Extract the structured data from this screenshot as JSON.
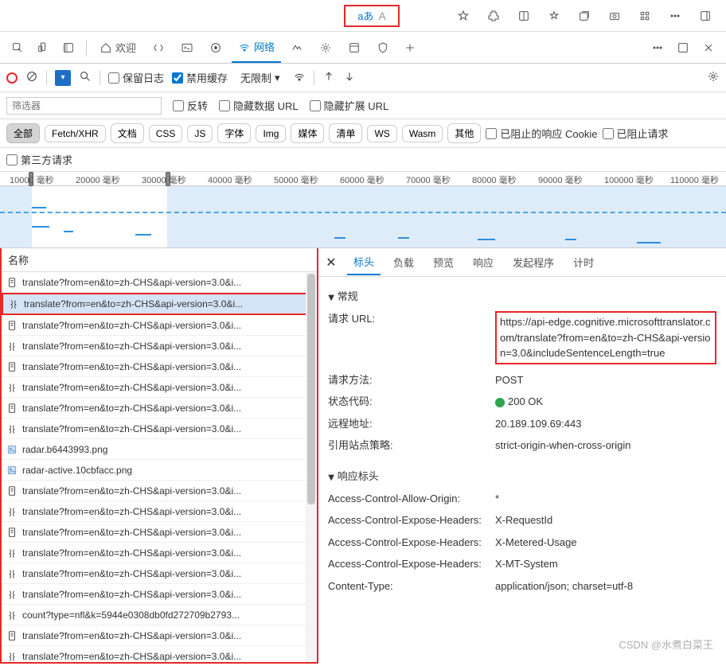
{
  "browserBar": {
    "translateBtn": {
      "label1": "aあ",
      "label2": "A"
    }
  },
  "tabs": {
    "welcome": "欢迎",
    "network": "网络"
  },
  "controls": {
    "preserveLog": "保留日志",
    "disableCache": "禁用缓存",
    "throttle": "无限制"
  },
  "filterRow": {
    "placeholder": "筛选器",
    "invert": "反转",
    "hideDataUrl": "隐藏数据 URL",
    "hideExtUrl": "隐藏扩展 URL"
  },
  "typeRow": {
    "all": "全部",
    "fetch": "Fetch/XHR",
    "doc": "文档",
    "css": "CSS",
    "js": "JS",
    "font": "字体",
    "img": "Img",
    "media": "媒体",
    "manifest": "清单",
    "ws": "WS",
    "wasm": "Wasm",
    "other": "其他",
    "blockedCookie": "已阻止的响应 Cookie",
    "blockedReq": "已阻止请求"
  },
  "thirdParty": "第三方请求",
  "timeline": {
    "ticks": [
      "10000 毫秒",
      "20000 毫秒",
      "30000 毫秒",
      "40000 毫秒",
      "50000 毫秒",
      "60000 毫秒",
      "70000 毫秒",
      "80000 毫秒",
      "90000 毫秒",
      "100000 毫秒",
      "110000 毫秒"
    ]
  },
  "listHeader": "名称",
  "requests": [
    {
      "name": "translate?from=en&to=zh-CHS&api-version=3.0&i...",
      "type": "doc",
      "selected": false
    },
    {
      "name": "translate?from=en&to=zh-CHS&api-version=3.0&i...",
      "type": "js",
      "selected": true
    },
    {
      "name": "translate?from=en&to=zh-CHS&api-version=3.0&i...",
      "type": "doc",
      "selected": false
    },
    {
      "name": "translate?from=en&to=zh-CHS&api-version=3.0&i...",
      "type": "js",
      "selected": false
    },
    {
      "name": "translate?from=en&to=zh-CHS&api-version=3.0&i...",
      "type": "doc",
      "selected": false
    },
    {
      "name": "translate?from=en&to=zh-CHS&api-version=3.0&i...",
      "type": "js",
      "selected": false
    },
    {
      "name": "translate?from=en&to=zh-CHS&api-version=3.0&i...",
      "type": "doc",
      "selected": false
    },
    {
      "name": "translate?from=en&to=zh-CHS&api-version=3.0&i...",
      "type": "js",
      "selected": false
    },
    {
      "name": "radar.b6443993.png",
      "type": "img",
      "selected": false
    },
    {
      "name": "radar-active.10cbfacc.png",
      "type": "img",
      "selected": false
    },
    {
      "name": "translate?from=en&to=zh-CHS&api-version=3.0&i...",
      "type": "doc",
      "selected": false
    },
    {
      "name": "translate?from=en&to=zh-CHS&api-version=3.0&i...",
      "type": "js",
      "selected": false
    },
    {
      "name": "translate?from=en&to=zh-CHS&api-version=3.0&i...",
      "type": "doc",
      "selected": false
    },
    {
      "name": "translate?from=en&to=zh-CHS&api-version=3.0&i...",
      "type": "js",
      "selected": false
    },
    {
      "name": "translate?from=en&to=zh-CHS&api-version=3.0&i...",
      "type": "js",
      "selected": false
    },
    {
      "name": "translate?from=en&to=zh-CHS&api-version=3.0&i...",
      "type": "js",
      "selected": false
    },
    {
      "name": "count?type=nfl&k=5944e0308db0fd272709b2793...",
      "type": "js",
      "selected": false
    },
    {
      "name": "translate?from=en&to=zh-CHS&api-version=3.0&i...",
      "type": "doc",
      "selected": false
    },
    {
      "name": "translate?from=en&to=zh-CHS&api-version=3.0&i...",
      "type": "js",
      "selected": false
    }
  ],
  "detailTabs": {
    "headers": "标头",
    "payload": "负载",
    "preview": "预览",
    "response": "响应",
    "initiator": "发起程序",
    "timing": "计时"
  },
  "general": {
    "title": "常规",
    "requestUrl": {
      "label": "请求 URL:",
      "value": "https://api-edge.cognitive.microsofttranslator.com/translate?from=en&to=zh-CHS&api-version=3.0&includeSentenceLength=true"
    },
    "method": {
      "label": "请求方法:",
      "value": "POST"
    },
    "status": {
      "label": "状态代码:",
      "value": "200 OK"
    },
    "remote": {
      "label": "远程地址:",
      "value": "20.189.109.69:443"
    },
    "referrer": {
      "label": "引用站点策略:",
      "value": "strict-origin-when-cross-origin"
    }
  },
  "responseHeaders": {
    "title": "响应标头",
    "rows": [
      {
        "k": "Access-Control-Allow-Origin:",
        "v": "*"
      },
      {
        "k": "Access-Control-Expose-Headers:",
        "v": "X-RequestId"
      },
      {
        "k": "Access-Control-Expose-Headers:",
        "v": "X-Metered-Usage"
      },
      {
        "k": "Access-Control-Expose-Headers:",
        "v": "X-MT-System"
      },
      {
        "k": "Content-Type:",
        "v": "application/json; charset=utf-8"
      }
    ]
  },
  "watermark": "CSDN @水煮白菜王"
}
